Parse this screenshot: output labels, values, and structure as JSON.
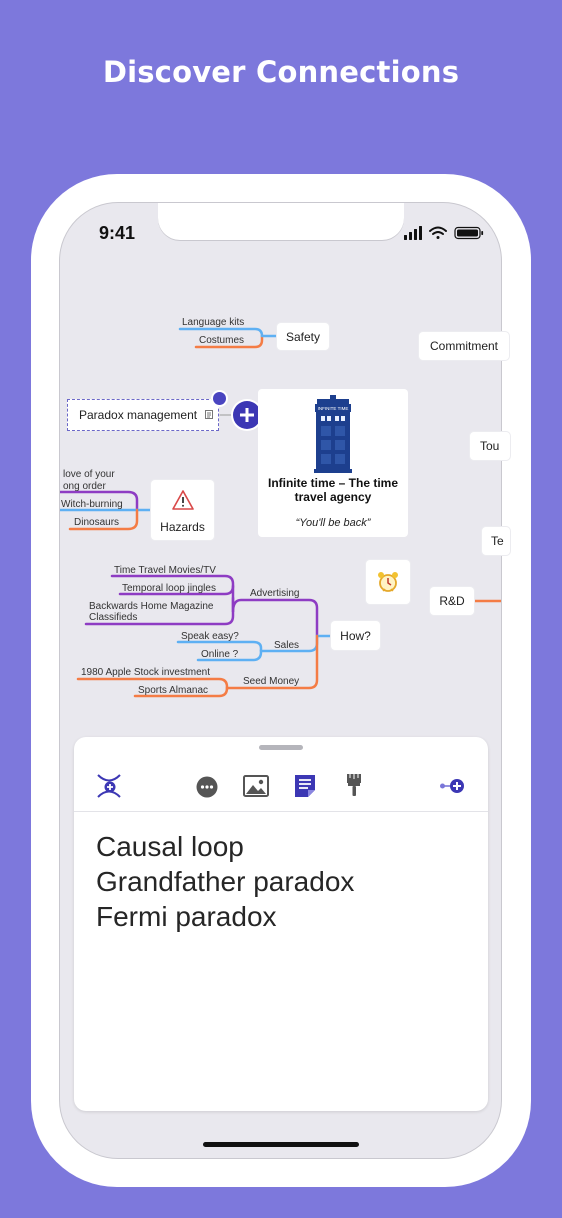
{
  "headline": "Discover Connections",
  "status_bar": {
    "time": "9:41"
  },
  "mindmap": {
    "central": {
      "title": "Infinite time – The time travel agency",
      "tagline": "“You'll be back”",
      "sign_text": "INFINITE TIME"
    },
    "nodes": {
      "safety": "Safety",
      "commitment": "Commitment",
      "paradox": "Paradox management",
      "hazards": "Hazards",
      "how": "How?",
      "rd": "R&D",
      "tou": "Tou",
      "te": "Te"
    },
    "labels": {
      "language_kits": "Language kits",
      "costumes": "Costumes",
      "love1": "love of your",
      "love2": "ong order",
      "witch": "Witch-burning",
      "dinosaurs": "Dinosaurs",
      "ttm": "Time Travel Movies/TV",
      "jingles": "Temporal loop jingles",
      "bhm1": "Backwards Home Magazine",
      "bhm2": "Classifieds",
      "advertising": "Advertising",
      "speak": "Speak easy?",
      "online": "Online ?",
      "sales": "Sales",
      "apple": "1980 Apple Stock investment",
      "almanac": "Sports Almanac",
      "seed": "Seed Money"
    },
    "colors": {
      "blue": "#5eb0f3",
      "orange": "#f47c45",
      "purple": "#8e3cc3",
      "accent": "#3c37b4",
      "tardis": "#1d3f8e"
    }
  },
  "panel": {
    "toolbar": {
      "connect": "connect-icon",
      "more": "more-icon",
      "image": "image-icon",
      "notes": "notes-icon",
      "style": "brush-icon",
      "add": "add-topic-icon"
    },
    "notes": [
      "Causal loop",
      "Grandfather paradox",
      "Fermi paradox"
    ]
  }
}
